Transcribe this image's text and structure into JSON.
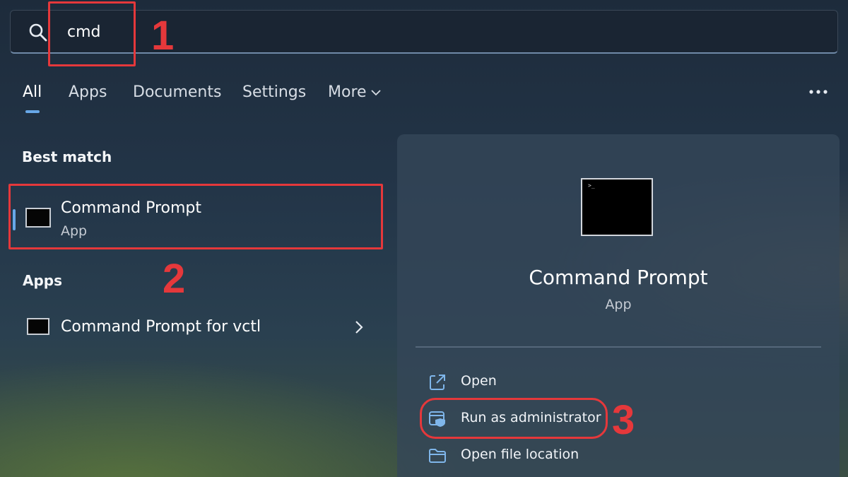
{
  "search": {
    "query": "cmd"
  },
  "annotations": {
    "step1": "1",
    "step2": "2",
    "step3": "3"
  },
  "tabs": [
    {
      "label": "All",
      "active": true
    },
    {
      "label": "Apps"
    },
    {
      "label": "Documents"
    },
    {
      "label": "Settings"
    },
    {
      "label": "More"
    }
  ],
  "best_match": {
    "section_title": "Best match",
    "name": "Command Prompt",
    "type": "App"
  },
  "apps": {
    "section_title": "Apps",
    "items": [
      {
        "name": "Command Prompt for vctl"
      }
    ]
  },
  "detail": {
    "name": "Command Prompt",
    "type": "App",
    "actions": [
      {
        "label": "Open",
        "icon": "open-external-icon"
      },
      {
        "label": "Run as administrator",
        "icon": "shield-window-icon"
      },
      {
        "label": "Open file location",
        "icon": "folder-icon"
      }
    ]
  },
  "colors": {
    "annotation": "#e5383b",
    "accent": "#68a8e8"
  }
}
